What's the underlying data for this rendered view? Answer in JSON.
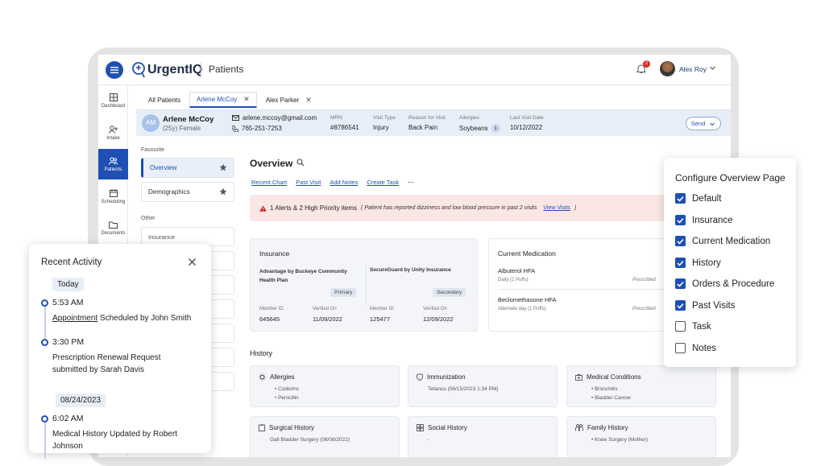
{
  "app": {
    "name": "UrgentIQ",
    "page": "Patients"
  },
  "header": {
    "user_name": "Alex Roy",
    "notification_count": "2"
  },
  "sidebar": {
    "items": [
      {
        "label": "Dashboard",
        "icon": "dashboard-icon"
      },
      {
        "label": "Intake",
        "icon": "user-plus-icon"
      },
      {
        "label": "Patients",
        "icon": "users-icon",
        "active": true
      },
      {
        "label": "Scheduling",
        "icon": "calendar-icon"
      },
      {
        "label": "Documents",
        "icon": "folder-icon"
      }
    ]
  },
  "tabs": [
    {
      "label": "All Patients"
    },
    {
      "label": "Arlene McCoy",
      "active": true
    },
    {
      "label": "Alex Parker"
    }
  ],
  "patient": {
    "initials": "AM",
    "name": "Arlene McCoy",
    "sub": "(25y) Female",
    "email": "arlene.mccoy@gmail.com",
    "phone": "765-251-7253",
    "fields": [
      {
        "label": "MRN",
        "value": "#8786541"
      },
      {
        "label": "Visit Type",
        "value": "Injury"
      },
      {
        "label": "Reason for Visit",
        "value": "Back Pain"
      },
      {
        "label": "Allergies",
        "value": "Soybeans",
        "count": "1"
      },
      {
        "label": "Last Visit Date",
        "value": "10/12/2022"
      }
    ],
    "send_label": "Send"
  },
  "left_panel": {
    "favourite_label": "Favourite",
    "favourites": [
      "Overview",
      "Demographics"
    ],
    "other_label": "Other",
    "other": [
      "Insurance"
    ]
  },
  "overview": {
    "title": "Overview",
    "links": [
      "Recent Chart",
      "Past Visit",
      "Add Notes",
      "Create Task"
    ],
    "more": "···",
    "alert": {
      "text": "1 Alerts & 2 High Priority items",
      "detail": "( Patient has reported dizziness and low blood pressure in past 2 visits",
      "link": "View Visits",
      "close": ")"
    },
    "insurance": {
      "title": "Insurance",
      "plans": [
        {
          "name": "Advantage by Buckeye Community Health Plan",
          "badge": "Primary",
          "member_id_label": "Member ID",
          "member_id": "645645",
          "verified_label": "Verified On",
          "verified": "11/09/2022"
        },
        {
          "name": "SecureGuard by Unity Insurance",
          "badge": "Secondary",
          "member_id_label": "Member ID",
          "member_id": "125477",
          "verified_label": "Verified On",
          "verified": "12/09/2022"
        }
      ]
    },
    "medication": {
      "title": "Current Medication",
      "items": [
        {
          "name": "Albuterol HFA",
          "dose": "Daily (2 Puffs)",
          "status": "Prescribed"
        },
        {
          "name": "Beclomethasone HFA",
          "dose": "Alternate day (1 Puffs)",
          "status": "Prescribed"
        }
      ]
    },
    "history_label": "History",
    "history": [
      {
        "title": "Allergies",
        "items": [
          "Coderins",
          "Penicillin"
        ]
      },
      {
        "title": "Immunization",
        "items": [
          "Tetanus (06/15/2023 1:34 PM)"
        ]
      },
      {
        "title": "Medical Conditions",
        "items": [
          "Bronchitis",
          "Bladder Cancer"
        ]
      },
      {
        "title": "Surgical History",
        "items": [
          "Gall Bladder Surgery (08/08/2022)"
        ]
      },
      {
        "title": "Social History",
        "items": [
          "-"
        ]
      },
      {
        "title": "Family History",
        "items": [
          "Knee Surgery (Mother)"
        ]
      }
    ]
  },
  "config_panel": {
    "title": "Configure Overview Page",
    "options": [
      {
        "label": "Default",
        "checked": true
      },
      {
        "label": "Insurance",
        "checked": true
      },
      {
        "label": "Current Medication",
        "checked": true
      },
      {
        "label": "History",
        "checked": true
      },
      {
        "label": "Orders & Procedure",
        "checked": true
      },
      {
        "label": "Past Visits",
        "checked": true
      },
      {
        "label": "Task",
        "checked": false
      },
      {
        "label": "Notes",
        "checked": false
      }
    ]
  },
  "recent_activity": {
    "title": "Recent Activity",
    "groups": [
      {
        "day": "Today",
        "events": [
          {
            "time": "5:53 AM",
            "link": "Appointment",
            "text": " Scheduled by John Smith"
          },
          {
            "time": "3:30 PM",
            "text": "Prescription Renewal Request submitted by Sarah Davis"
          }
        ]
      },
      {
        "day": "08/24/2023",
        "events": [
          {
            "time": "6:02 AM",
            "text": "Medical History Updated by Robert Johnson"
          }
        ]
      }
    ]
  },
  "colors": {
    "primary": "#1e50b4",
    "alert_bg": "#fbe6e6",
    "patient_bar": "#e8eef8"
  }
}
